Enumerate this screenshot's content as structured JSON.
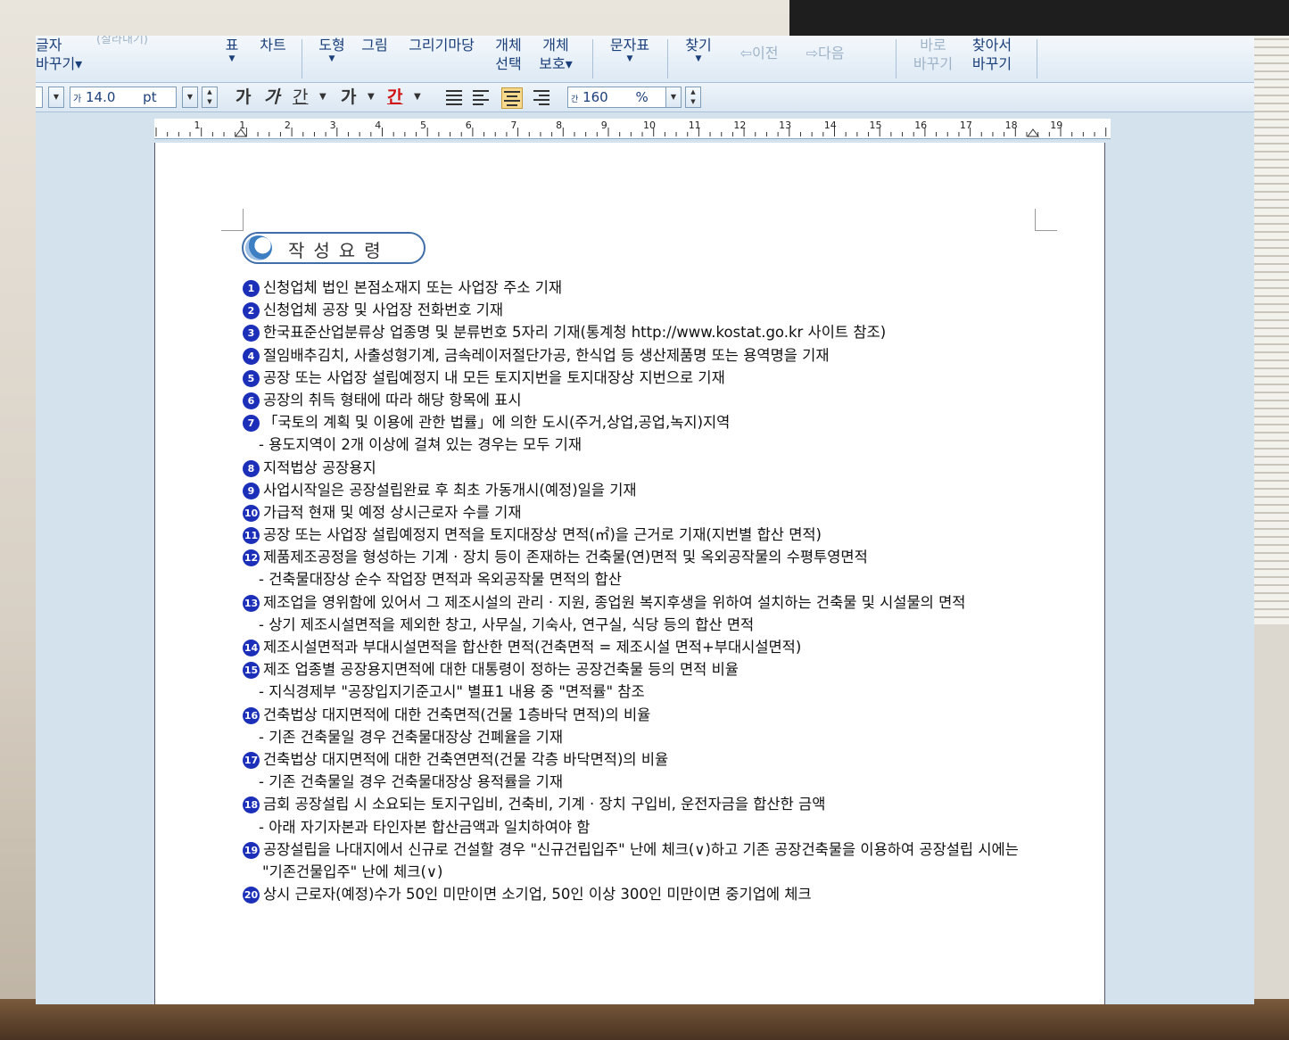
{
  "toolbar": {
    "change_char": [
      "글자",
      "바꾸기"
    ],
    "cut_label": "(잘라내기)",
    "table": "표",
    "chart": "차트",
    "shapes": "도형",
    "picture": "그림",
    "drawing_market": "그리기마당",
    "object_select": [
      "개체",
      "선택"
    ],
    "object_protect": [
      "개체",
      "보호"
    ],
    "char_map": "문자표",
    "find": "찾기",
    "prev": "이전",
    "next": "다음",
    "replace": [
      "바로",
      "바꾸기"
    ],
    "find_replace": [
      "찾아서",
      "바꾸기"
    ]
  },
  "format_bar": {
    "font_size_icon": "가",
    "font_size": "14.0",
    "unit": "pt",
    "bold": "가",
    "italic": "가",
    "underline": "간",
    "superscript": "가",
    "font_color": "간",
    "line_spacing_icon": "간",
    "line_spacing": "160",
    "line_spacing_unit": "%"
  },
  "ruler": {
    "marks": [
      "1",
      "1",
      "2",
      "3",
      "4",
      "5",
      "6",
      "7",
      "8",
      "9",
      "10",
      "11",
      "12",
      "13",
      "14",
      "15",
      "16",
      "17",
      "18",
      "19"
    ]
  },
  "document": {
    "heading": "작성요령",
    "items": [
      {
        "num": "1",
        "text": "신청업체 법인 본점소재지 또는 사업장 주소 기재"
      },
      {
        "num": "2",
        "text": "신청업체 공장 및 사업장 전화번호 기재"
      },
      {
        "num": "3",
        "text": "한국표준산업분류상 업종명 및 분류번호 5자리 기재(통계청 http://www.kostat.go.kr 사이트 참조)"
      },
      {
        "num": "4",
        "text": "절임배추김치, 사출성형기계, 금속레이저절단가공, 한식업 등 생산제품명 또는 용역명을 기재"
      },
      {
        "num": "5",
        "text": "공장 또는 사업장 설립예정지 내 모든 토지지번을 토지대장상 지번으로 기재"
      },
      {
        "num": "6",
        "text": "공장의 취득 형태에 따라 해당 항목에 표시"
      },
      {
        "num": "7",
        "text": "「국토의 계획 및 이용에 관한 법률」에 의한 도시(주거,상업,공업,녹지)지역"
      },
      {
        "sub": "- 용도지역이 2개 이상에 걸쳐 있는 경우는 모두 기재"
      },
      {
        "num": "8",
        "text": "지적법상 공장용지"
      },
      {
        "num": "9",
        "text": "사업시작일은 공장설립완료 후 최초 가동개시(예정)일을 기재"
      },
      {
        "num": "10",
        "text": "가급적 현재 및 예정 상시근로자 수를 기재"
      },
      {
        "num": "11",
        "text": "공장 또는 사업장 설립예정지 면적을 토지대장상 면적(㎡)을 근거로 기재(지번별 합산 면적)"
      },
      {
        "num": "12",
        "text": "제품제조공정을 형성하는 기계 · 장치 등이 존재하는 건축물(연)면적 및 옥외공작물의 수평투영면적"
      },
      {
        "sub": "- 건축물대장상 순수 작업장 면적과 옥외공작물 면적의 합산"
      },
      {
        "num": "13",
        "text": "제조업을 영위함에 있어서 그 제조시설의 관리 · 지원, 종업원 복지후생을 위하여 설치하는 건축물 및 시설물의 면적"
      },
      {
        "sub": "- 상기 제조시설면적을 제외한 창고, 사무실, 기숙사, 연구실, 식당 등의 합산 면적"
      },
      {
        "num": "14",
        "text": "제조시설면적과 부대시설면적을 합산한 면적(건축면적 = 제조시설 면적+부대시설면적)"
      },
      {
        "num": "15",
        "text": "제조 업종별 공장용지면적에 대한 대통령이 정하는 공장건축물 등의 면적 비율"
      },
      {
        "sub": "- 지식경제부 \"공장입지기준고시\" 별표1 내용 중 \"면적률\" 참조"
      },
      {
        "num": "16",
        "text": "건축법상 대지면적에 대한 건축면적(건물 1층바닥 면적)의 비율"
      },
      {
        "sub": "- 기존 건축물일 경우 건축물대장상 건폐율을 기재"
      },
      {
        "num": "17",
        "text": "건축법상 대지면적에 대한 건축연면적(건물 각층 바닥면적)의 비율"
      },
      {
        "sub": "- 기존 건축물일 경우 건축물대장상 용적률을 기재"
      },
      {
        "num": "18",
        "text": "금회 공장설립 시 소요되는 토지구입비, 건축비, 기계 · 장치 구입비, 운전자금을 합산한 금액"
      },
      {
        "sub": "- 아래 자기자본과 타인자본 합산금액과 일치하여야 함"
      },
      {
        "num": "19",
        "text": "공장설립을 나대지에서 신규로 건설할 경우 \"신규건립입주\" 난에 체크(∨)하고 기존 공장건축물을 이용하여 공장설립 시에는"
      },
      {
        "cont": "\"기존건물입주\" 난에 체크(∨)"
      },
      {
        "num": "20",
        "text": "상시 근로자(예정)수가 50인 미만이면 소기업, 50인 이상 300인 미만이면 중기업에 체크"
      }
    ]
  }
}
